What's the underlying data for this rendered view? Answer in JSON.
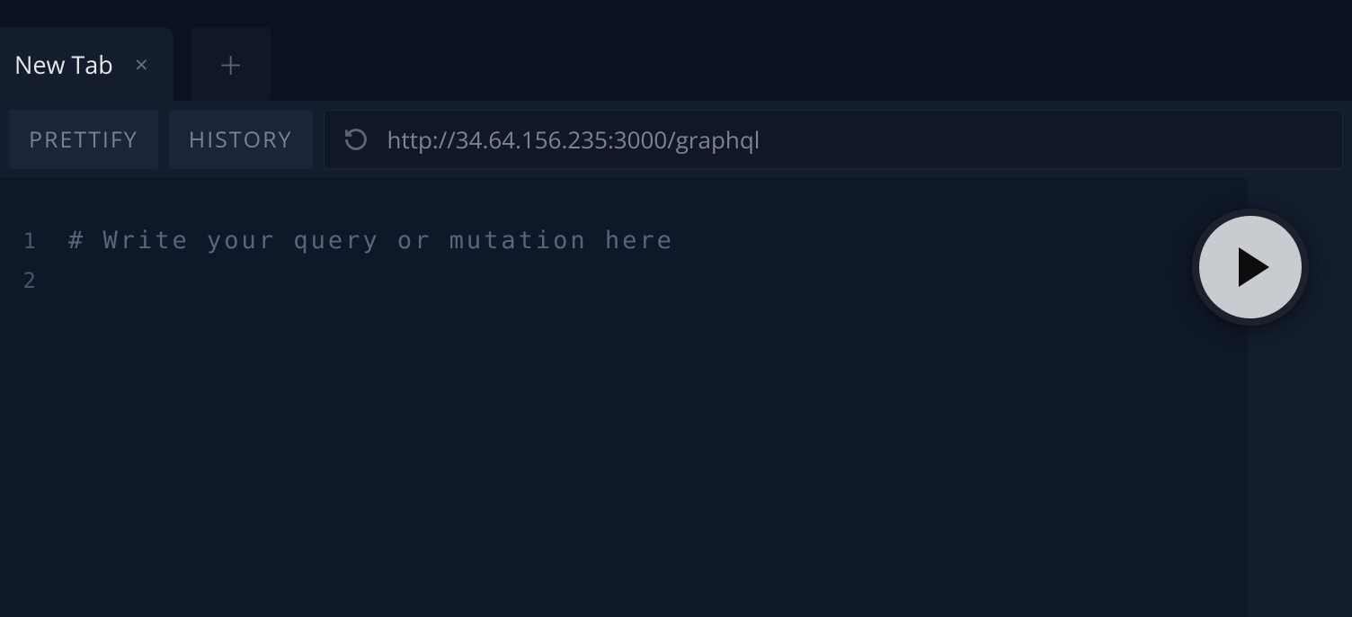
{
  "tabs": {
    "active": {
      "label": "New Tab"
    }
  },
  "toolbar": {
    "prettify_label": "PRETTIFY",
    "history_label": "HISTORY"
  },
  "url": {
    "value": "http://34.64.156.235:3000/graphql"
  },
  "editor": {
    "line_numbers": [
      "1",
      "2"
    ],
    "lines": [
      "# Write your query or mutation here",
      ""
    ]
  }
}
